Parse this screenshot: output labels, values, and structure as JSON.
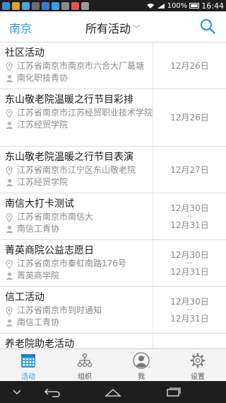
{
  "status_bar": {
    "battery": "100%",
    "time": "16:44"
  },
  "header": {
    "city": "南京",
    "title": "所有活动"
  },
  "activities": [
    {
      "title": "社区活动",
      "location": "江苏省南京市南京市六合大厂葛塘",
      "organizer": "南化职技青协",
      "date_start": "12月26日",
      "date_end": ""
    },
    {
      "title": "东山敬老院温暖之行节目彩排",
      "location": "江苏省南京市江苏经贸职业技术学院",
      "organizer": "江苏经贸学院",
      "date_start": "12月26日",
      "date_end": ""
    },
    {
      "title": "东山敬老院温暖之行节目表演",
      "location": "江苏省南京市江宁区东山敬老院",
      "organizer": "江苏经贸学院",
      "date_start": "12月27日",
      "date_end": ""
    },
    {
      "title": "南信大打卡测试",
      "location": "江苏省南京市南信大",
      "organizer": "南信工青协",
      "date_start": "12月30日",
      "date_sep": "--",
      "date_end": "12月31日"
    },
    {
      "title": "菁英商院公益志愿日",
      "location": "江苏省南京市秦虹南路176号",
      "organizer": "菁英商学院",
      "date_start": "12月30日",
      "date_sep": "--",
      "date_end": "12月31日"
    },
    {
      "title": "信工活动",
      "location": "江苏省南京市到时通知",
      "organizer": "南信工青协",
      "date_start": "12月30日",
      "date_sep": "--",
      "date_end": "12月31日"
    },
    {
      "title": "养老院助老活动",
      "location": "",
      "organizer": "",
      "date_start": "",
      "date_end": ""
    }
  ],
  "tabs": [
    {
      "label": "活动",
      "icon": "calendar-grid-icon",
      "active": true
    },
    {
      "label": "组织",
      "icon": "org-chart-icon",
      "active": false
    },
    {
      "label": "我",
      "icon": "person-icon",
      "active": false
    },
    {
      "label": "设置",
      "icon": "gear-icon",
      "active": false
    }
  ],
  "colors": {
    "accent": "#2e9cdf",
    "text": "#222222",
    "muted": "#8a8a8a"
  }
}
